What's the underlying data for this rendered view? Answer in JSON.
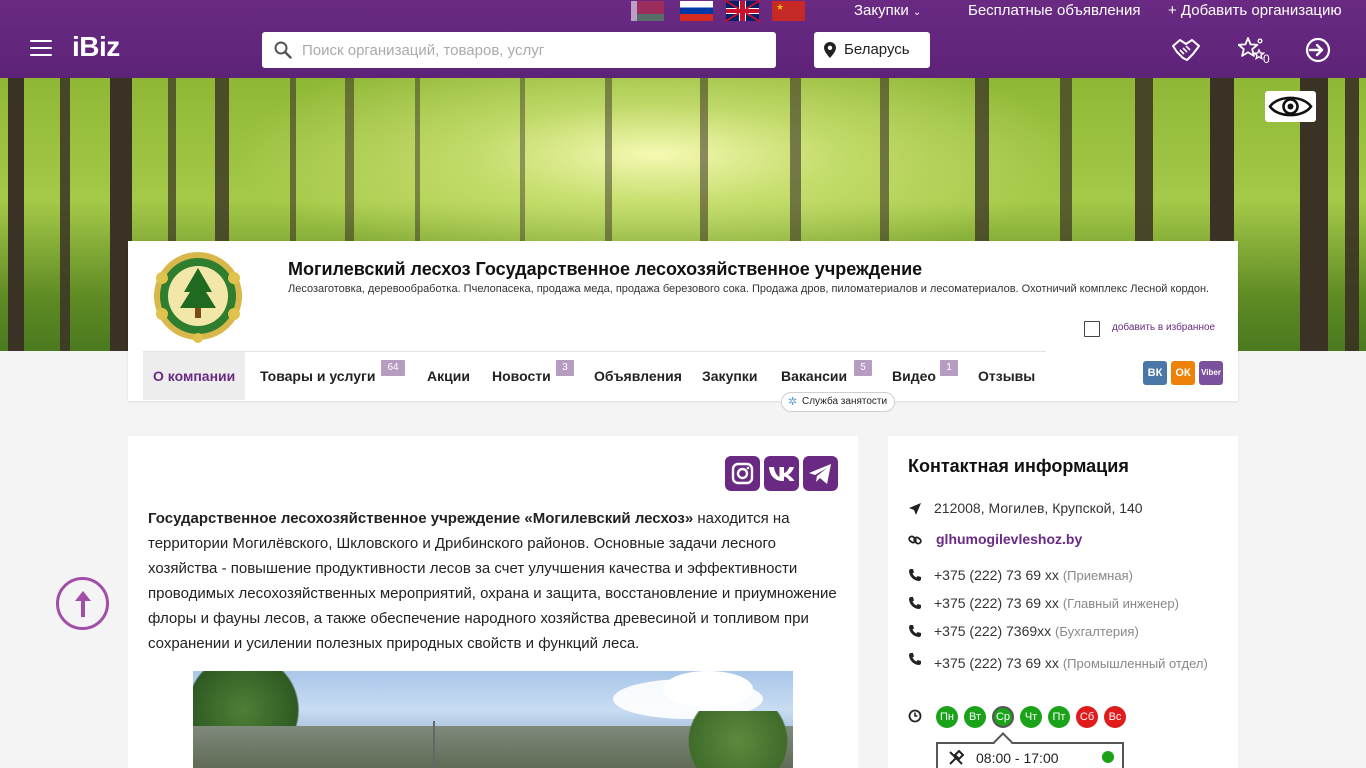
{
  "header": {
    "links": {
      "purchases": "Закупки",
      "free_ads": "Бесплатные объявления",
      "add_org": "+ Добавить организацию"
    },
    "logo": "iBiz",
    "search": {
      "placeholder": "Поиск организаций, товаров, услуг"
    },
    "region": "Беларусь",
    "favorites_count": "0",
    "colors": {
      "brand": "#6a2a83"
    }
  },
  "company": {
    "title": "Могилевский лесхоз Государственное лесохозяйственное учреждение",
    "description": "Лесозаготовка, деревообработка. Пчелопасека, продажа меда, продажа березового сока. Продажа дров, пиломатериалов и лесоматериалов. Охотничий комплекс Лесной кордон.",
    "favorite_label": "добавить в избранное"
  },
  "tabs": [
    {
      "label": "О компании",
      "badge": ""
    },
    {
      "label": "Товары и услуги",
      "badge": "64"
    },
    {
      "label": "Акции",
      "badge": ""
    },
    {
      "label": "Новости",
      "badge": "3"
    },
    {
      "label": "Объявления",
      "badge": ""
    },
    {
      "label": "Закупки",
      "badge": ""
    },
    {
      "label": "Вакансии",
      "badge": "5"
    },
    {
      "label": "Видео",
      "badge": "1"
    },
    {
      "label": "Отзывы",
      "badge": ""
    }
  ],
  "vacancy_tooltip": "Служба занятости",
  "share": [
    "ВК",
    "ОК",
    "Viber"
  ],
  "about": {
    "bold": "Государственное лесохозяйственное учреждение «Могилевский лесхоз»",
    "text": " находится на территории Могилёвского, Шкловского и Дрибинского районов. Основные задачи лесного хозяйства - повышение продуктивности лесов за счет улучшения качества и эффективности проводимых лесохозяйственных мероприятий, охрана и защита, восстановление и приумножение флоры и фауны лесов, а также обеспечение народного хозяйства древесиной и топливом при сохранении и усилении полезных природных свойств и функций леса."
  },
  "contact": {
    "title": "Контактная информация",
    "address": "212008, Могилев, Крупской, 140",
    "site": "glhumogilevleshoz.by",
    "phones": [
      {
        "number": "+375 (222) 73 69 xx",
        "note": "(Приемная)"
      },
      {
        "number": "+375 (222) 73 69 xx",
        "note": "(Главный инженер)"
      },
      {
        "number": "+375 (222) 7369xx",
        "note": "(Бухгалтерия)"
      },
      {
        "number": "+375 (222) 73 69 xx",
        "note": "(Промышленный отдел)"
      }
    ],
    "days": [
      {
        "label": "Пн",
        "status": "work"
      },
      {
        "label": "Вт",
        "status": "work"
      },
      {
        "label": "Ср",
        "status": "work"
      },
      {
        "label": "Чт",
        "status": "work"
      },
      {
        "label": "Пт",
        "status": "work"
      },
      {
        "label": "Сб",
        "status": "off"
      },
      {
        "label": "Вс",
        "status": "off"
      }
    ],
    "hours": "08:00 - 17:00"
  }
}
